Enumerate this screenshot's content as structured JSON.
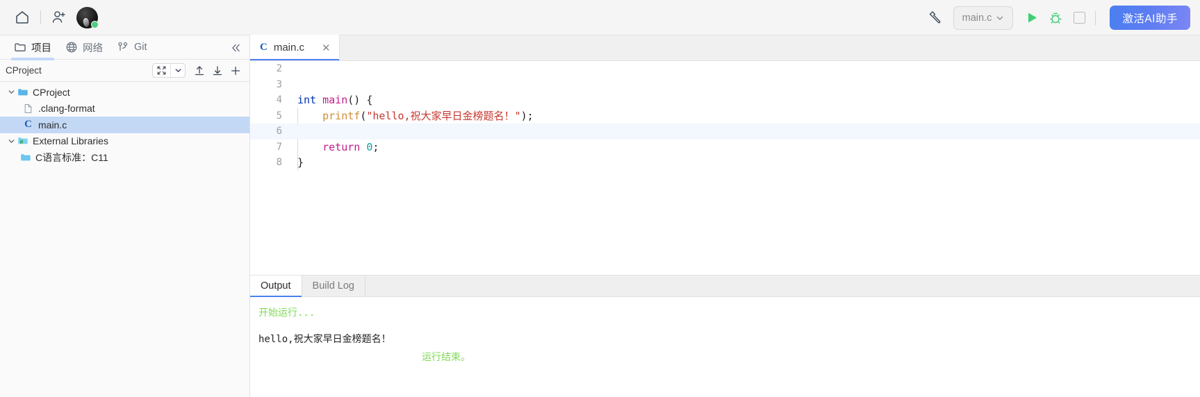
{
  "topbar": {
    "home_icon": "home-icon",
    "add_user_icon": "add-user-icon",
    "avatar_name": "user-avatar",
    "presence_status": "online",
    "build_icon": "hammer-icon",
    "file_selector_value": "main.c",
    "run_icon": "run-triangle-icon",
    "debug_icon": "debug-bug-icon",
    "stop_icon": "stop-square-icon",
    "ai_button_label": "激活AI助手",
    "accent_blue": "#4a7ff0",
    "run_green": "#3ecf73"
  },
  "sidebar": {
    "tabs": [
      {
        "label": "项目",
        "icon": "folder-icon",
        "active": true
      },
      {
        "label": "网络",
        "icon": "globe-icon",
        "active": false
      },
      {
        "label": "Git",
        "icon": "git-branch-icon",
        "active": false
      }
    ],
    "collapse_icon": "chevron-double-left-icon",
    "project_header": {
      "title": "CProject",
      "expand_icon": "expand-arrows-icon",
      "dropdown_icon": "chevron-down-icon",
      "upload_icon": "upload-icon",
      "download_icon": "download-icon",
      "add_icon": "plus-icon"
    },
    "tree": [
      {
        "label": "CProject",
        "icon": "folder-blue-icon",
        "indent": 0,
        "expanded": true,
        "selected": false
      },
      {
        "label": ".clang-format",
        "icon": "file-generic-icon",
        "indent": 1,
        "expanded": null,
        "selected": false
      },
      {
        "label": "main.c",
        "icon": "c-file-icon",
        "indent": 1,
        "expanded": null,
        "selected": true
      },
      {
        "label": "External Libraries",
        "icon": "library-folder-icon",
        "indent": 0,
        "expanded": true,
        "selected": false
      },
      {
        "label": "C语言标准：C11",
        "icon": "folder-blue-icon",
        "indent": 1,
        "expanded": null,
        "selected": false
      }
    ],
    "selection_color": "#c3d8f5"
  },
  "editor": {
    "tabs": [
      {
        "label": "main.c",
        "badge": "C",
        "active": true,
        "close_icon": "close-icon"
      }
    ],
    "lines": [
      {
        "num": "2",
        "highlight": false,
        "tokens": []
      },
      {
        "num": "3",
        "highlight": false,
        "tokens": []
      },
      {
        "num": "4",
        "highlight": false,
        "tokens": [
          {
            "t": "int",
            "c": "kw"
          },
          {
            "t": " ",
            "c": "pl"
          },
          {
            "t": "main",
            "c": "fn"
          },
          {
            "t": "() {",
            "c": "pl"
          }
        ]
      },
      {
        "num": "5",
        "highlight": false,
        "tokens": [
          {
            "t": "    ",
            "c": "pl"
          },
          {
            "t": "printf",
            "c": "fname"
          },
          {
            "t": "(",
            "c": "pl"
          },
          {
            "t": "\"hello,祝大家早日金榜题名！\"",
            "c": "str"
          },
          {
            "t": ");",
            "c": "pl"
          }
        ]
      },
      {
        "num": "6",
        "highlight": true,
        "tokens": []
      },
      {
        "num": "7",
        "highlight": false,
        "tokens": [
          {
            "t": "    ",
            "c": "pl"
          },
          {
            "t": "return",
            "c": "fn"
          },
          {
            "t": " ",
            "c": "pl"
          },
          {
            "t": "0",
            "c": "num"
          },
          {
            "t": ";",
            "c": "pl"
          }
        ]
      },
      {
        "num": "8",
        "highlight": false,
        "tokens": [
          {
            "t": "}",
            "c": "pl"
          }
        ]
      }
    ]
  },
  "panel": {
    "tabs": [
      {
        "label": "Output",
        "active": true
      },
      {
        "label": "Build Log",
        "active": false
      }
    ],
    "output": {
      "start_line": "开始运行...",
      "program_output": "hello,祝大家早日金榜题名！",
      "end_line": "运行结束。",
      "green": "#7fd957"
    }
  }
}
